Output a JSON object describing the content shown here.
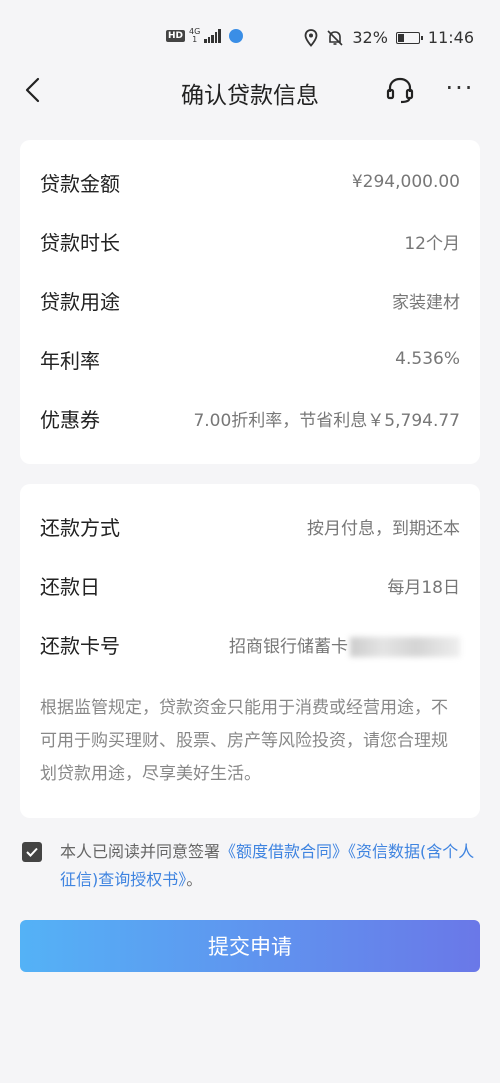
{
  "status_bar": {
    "hd": "HD",
    "net_gen": "4G",
    "net_sub": "1",
    "battery_percent": "32%",
    "battery_level": 0.32,
    "time": "11:46"
  },
  "nav": {
    "title": "确认贷款信息",
    "more": "···"
  },
  "loan_info": {
    "rows": [
      {
        "label": "贷款金额",
        "value": "¥294,000.00"
      },
      {
        "label": "贷款时长",
        "value": "12个月"
      },
      {
        "label": "贷款用途",
        "value": "家装建材"
      },
      {
        "label": "年利率",
        "value": "4.536%"
      },
      {
        "label": "优惠券",
        "value": "7.00折利率，节省利息￥5,794.77"
      }
    ]
  },
  "repay_info": {
    "rows": [
      {
        "label": "还款方式",
        "value": "按月付息，到期还本"
      },
      {
        "label": "还款日",
        "value": "每月18日"
      },
      {
        "label": "还款卡号",
        "value": "招商银行储蓄卡"
      }
    ],
    "notice": "根据监管规定，贷款资金只能用于消费或经营用途，不可用于购买理财、股票、房产等风险投资，请您合理规划贷款用途，尽享美好生活。"
  },
  "agreement": {
    "checked": true,
    "prefix": "本人已阅读并同意签署",
    "link1": "《额度借款合同》",
    "link2": "《资信数据(含个人征信)查询授权书》",
    "suffix": "。"
  },
  "submit": {
    "label": "提交申请",
    "gradient_start": "#54b2f6",
    "gradient_end": "#6a78e8"
  }
}
